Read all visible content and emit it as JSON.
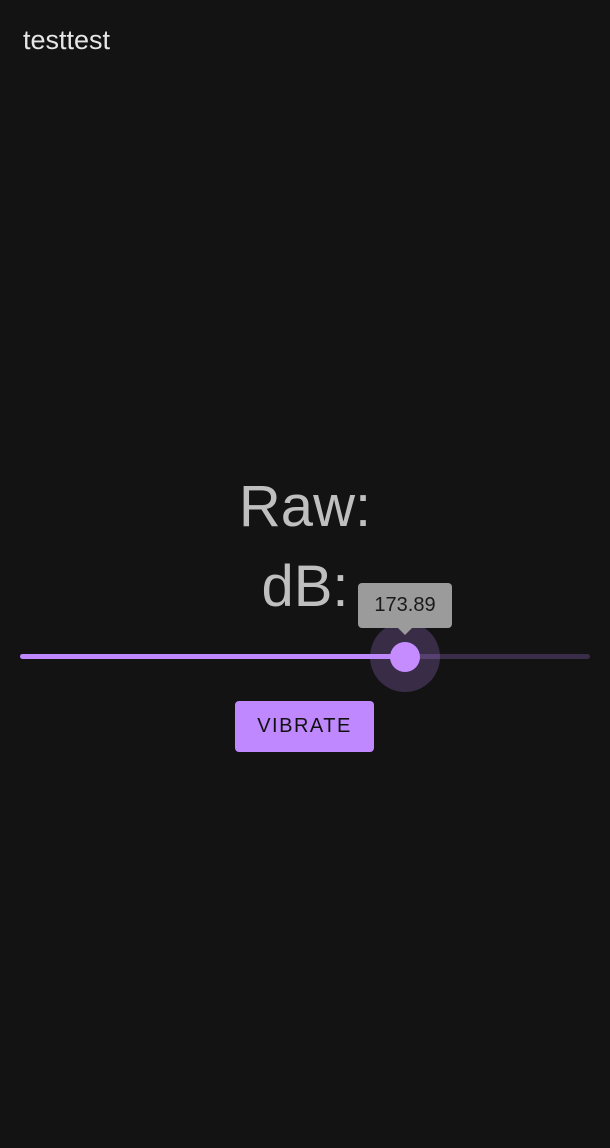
{
  "app": {
    "title": "testtest"
  },
  "readouts": {
    "raw_label": "Raw:",
    "db_label": "dB:"
  },
  "slider": {
    "tooltip_value": "173.89",
    "fraction": 0.676,
    "active_color": "#bf88ff",
    "inactive_color": "#3a2d4a"
  },
  "actions": {
    "vibrate_label": "VIBRATE"
  },
  "colors": {
    "background": "#131314",
    "accent": "#bf88ff",
    "text": "#bfbfbf"
  }
}
